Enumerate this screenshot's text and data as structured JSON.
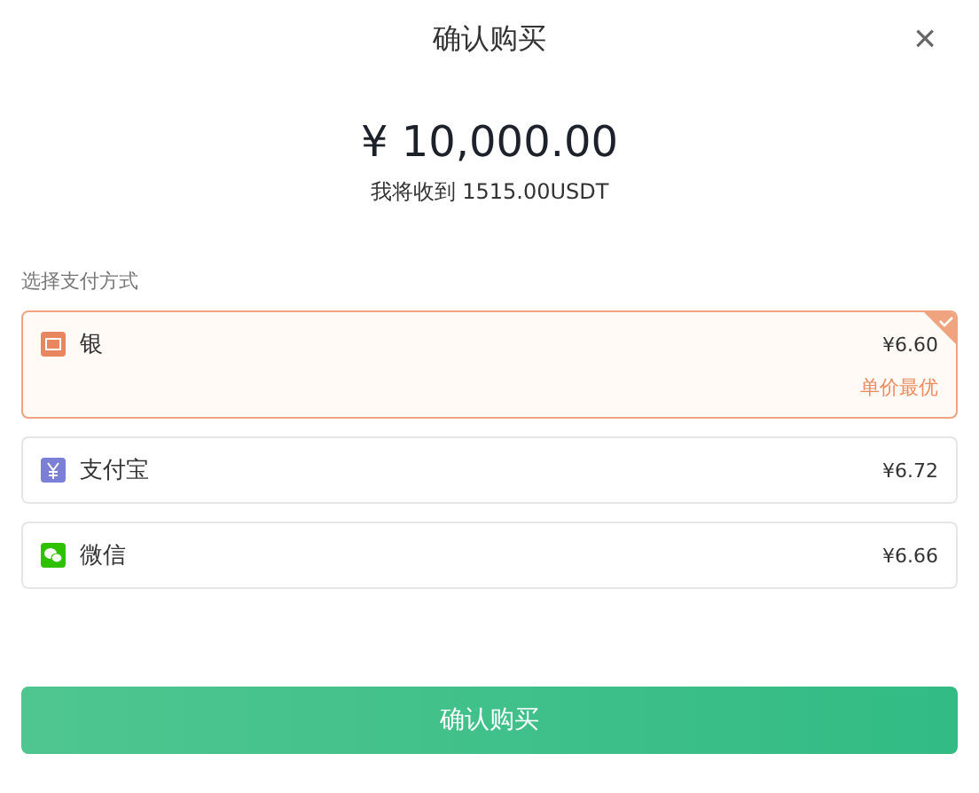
{
  "dialog": {
    "title": "确认购买",
    "close": "×"
  },
  "amount": "¥ 10,000.00",
  "receive": "我将收到 1515.00USDT",
  "payment": {
    "label": "选择支付方式",
    "methods": [
      {
        "kind": "bank",
        "name": "银",
        "price": "¥6.60",
        "badge": "单价最优",
        "selected": true
      },
      {
        "kind": "alipay",
        "name": "支付宝",
        "price": "¥6.72",
        "selected": false
      },
      {
        "kind": "wechat",
        "name": "微信",
        "price": "¥6.66",
        "selected": false
      }
    ]
  },
  "confirm": "确认购买"
}
